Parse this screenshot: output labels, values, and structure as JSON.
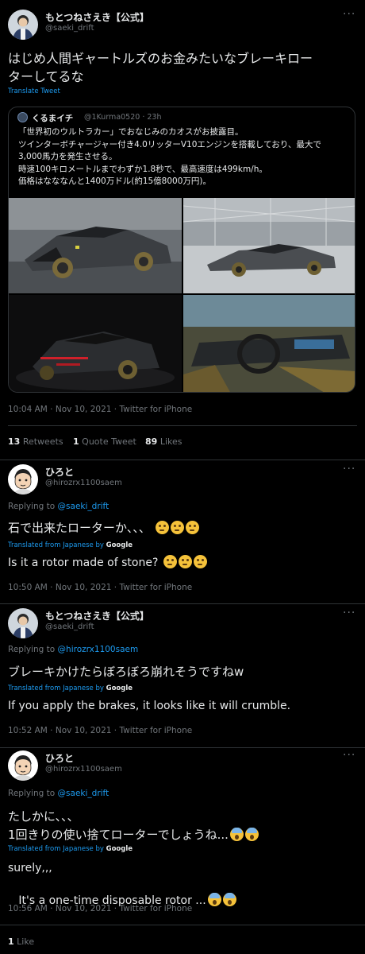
{
  "main_tweet": {
    "name": "もとつねさえき【公式】",
    "handle": "@saeki_drift",
    "text_line1": "はじめ人間ギャートルズのお金みたいなブレーキロー",
    "text_line2": "ターしてるな",
    "translate_label": "Translate Tweet",
    "quote": {
      "name": "くるまイチ",
      "handle_time": "@1Kurma0520 · 23h",
      "lines": [
        "「世界初のウルトラカー」でおなじみのカオスがお披露目。",
        "ツインターボチャージャー付き4.0リッターV10エンジンを搭載しており、最大で",
        "3,000馬力を発生させる。",
        "時速100キロメートルまでわずか1.8秒で、最高速度は499km/h。",
        "価格はなななんと1400万ドル(約15億8000万円)。"
      ]
    },
    "timestamp": "10:04 AM · Nov 10, 2021 · Twitter for iPhone",
    "stats": {
      "retweets_count": "13",
      "retweets_label": "Retweets",
      "quotes_count": "1",
      "quotes_label": "Quote Tweet",
      "likes_count": "89",
      "likes_label": "Likes"
    }
  },
  "replies": [
    {
      "name": "ひろと",
      "handle": "@hirozrx1100saem",
      "replying_prefix": "Replying to",
      "replying_to": "@saeki_drift",
      "text_jp": "石で出来たローターか、、、",
      "translated_prefix": "Translated from Japanese by",
      "translated_by": "Google",
      "text_en": "Is it a rotor made of stone?",
      "timestamp": "10:50 AM · Nov 10, 2021 · Twitter for iPhone"
    },
    {
      "name": "もとつねさえき【公式】",
      "handle": "@saeki_drift",
      "replying_prefix": "Replying to",
      "replying_to": "@hirozrx1100saem",
      "text_jp": "ブレーキかけたらぼろぼろ崩れそうですねw",
      "translated_prefix": "Translated from Japanese by",
      "translated_by": "Google",
      "text_en": "If you apply the brakes, it looks like it will crumble.",
      "timestamp": "10:52 AM · Nov 10, 2021 · Twitter for iPhone"
    },
    {
      "name": "ひろと",
      "handle": "@hirozrx1100saem",
      "replying_prefix": "Replying to",
      "replying_to": "@saeki_drift",
      "text_jp_line1": "たしかに、、、",
      "text_jp_line2": "1回きりの使い捨てローターでしょうね...",
      "translated_prefix": "Translated from Japanese by",
      "translated_by": "Google",
      "text_en_line1": "surely,,,",
      "text_en_line2": " It's a one-time disposable rotor ...",
      "timestamp": "10:56 AM · Nov 10, 2021 · Twitter for iPhone",
      "likes_count": "1",
      "likes_label": "Like"
    }
  ],
  "more_icon": "···",
  "colors": {
    "background": "#000000",
    "link": "#1d9bf0",
    "secondary": "#71767b",
    "border": "#2f3336"
  }
}
